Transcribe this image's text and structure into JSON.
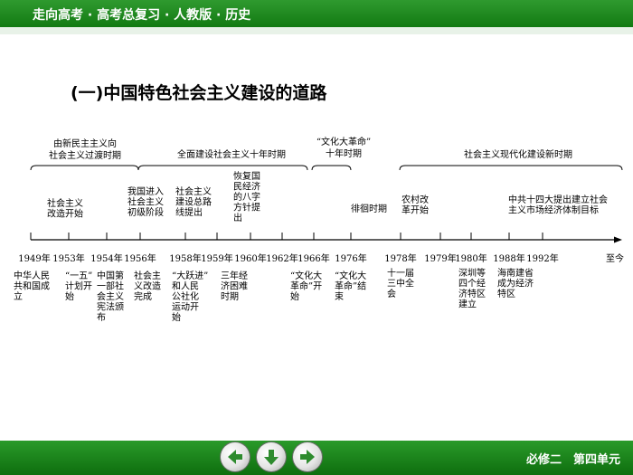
{
  "header": {
    "title": "走向高考 · 高考总复习 · 人教版 · 历史"
  },
  "page_heading": "(一)中国特色社会主义建设的道路",
  "periods": [
    {
      "lines": [
        "由新民主主义向",
        "社会主义过渡时期"
      ]
    },
    {
      "lines": [
        "全面建设社会主义十年时期"
      ]
    },
    {
      "lines": [
        "“文化大革命”",
        "十年时期"
      ]
    },
    {
      "lines": [
        "社会主义现代化建设新时期"
      ]
    }
  ],
  "upper_events": [
    {
      "lines": [
        "社会主义",
        "改造开始"
      ]
    },
    {
      "lines": [
        "我国进入",
        "社会主义",
        "初级阶段"
      ]
    },
    {
      "lines": [
        "社会主义",
        "建设总路",
        "线提出"
      ]
    },
    {
      "lines": [
        "恢复国",
        "民经济",
        "的八字",
        "方针提",
        "出"
      ]
    },
    {
      "lines": [
        "徘徊时期"
      ]
    },
    {
      "lines": [
        "农村改",
        "革开始"
      ]
    },
    {
      "lines": [
        "中共十四大提出建立社会",
        "主义市场经济体制目标"
      ]
    }
  ],
  "years": [
    "1949年",
    "1953年",
    "1954年",
    "1956年",
    "1958年",
    "1959年",
    "1960年",
    "1962年",
    "1966年",
    "1976年",
    "1978年",
    "1979年",
    "1980年",
    "1988年",
    "1992年",
    "至今"
  ],
  "lower_events": [
    {
      "lines": [
        "中华人民",
        "共和国成",
        "立"
      ]
    },
    {
      "lines": [
        "“一五”",
        "计划开",
        "始"
      ]
    },
    {
      "lines": [
        "中国第",
        "一部社",
        "会主义",
        "宪法颁",
        "布"
      ]
    },
    {
      "lines": [
        "社会主",
        "义改造",
        "完成"
      ]
    },
    {
      "lines": [
        "“大跃进”",
        "和人民",
        "公社化",
        "运动开",
        "始"
      ]
    },
    {
      "lines": [
        "三年经",
        "济困难",
        "时期"
      ]
    },
    {
      "lines": [
        "“文化大",
        "革命”开",
        "始"
      ]
    },
    {
      "lines": [
        "“文化大",
        "革命”结",
        "束"
      ]
    },
    {
      "lines": [
        "十一届",
        "三中全",
        "会"
      ]
    },
    {
      "lines": [
        "深圳等",
        "四个经",
        "济特区",
        "建立"
      ]
    },
    {
      "lines": [
        "海南建省",
        "成为经济",
        "特区"
      ]
    }
  ],
  "footer": {
    "label": "必修二　第四单元"
  },
  "nav": {
    "prev": "arrow-left-icon",
    "home": "arrow-down-icon",
    "next": "arrow-right-icon"
  },
  "colors": {
    "bar_green": "#1a8a1a",
    "arrow_green": "#2e8b2e"
  }
}
